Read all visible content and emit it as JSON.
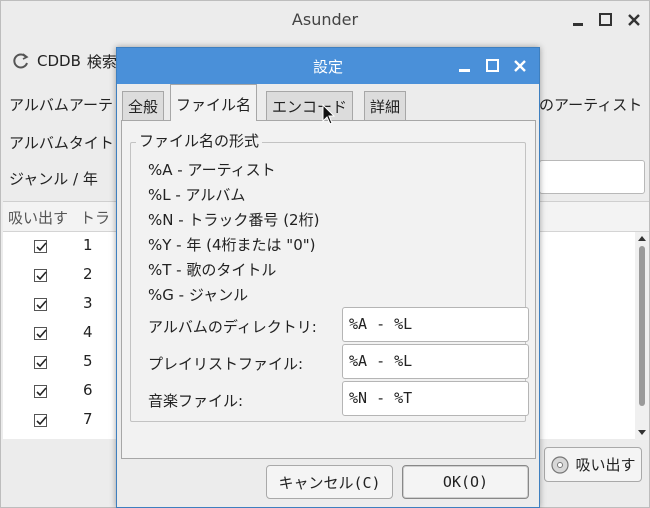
{
  "main": {
    "title": "Asunder",
    "toolbar": {
      "cddb_label": "CDDB",
      "lookup_label": "検索"
    },
    "artist_label": "アルバムアーテ",
    "album_title_label": "アルバムタイト",
    "genre_label": "ジャンル  /  年",
    "right_artist_label": "のアーティスト",
    "tracklist": {
      "headers": [
        "吸い出す",
        "トラ"
      ],
      "rows": [
        {
          "checked": true,
          "num": "1"
        },
        {
          "checked": true,
          "num": "2"
        },
        {
          "checked": true,
          "num": "3"
        },
        {
          "checked": true,
          "num": "4"
        },
        {
          "checked": true,
          "num": "5"
        },
        {
          "checked": true,
          "num": "6"
        },
        {
          "checked": true,
          "num": "7"
        }
      ]
    },
    "rip_button": "吸い出す"
  },
  "dialog": {
    "title": "設定",
    "tabs": [
      {
        "label": "全般",
        "active": false
      },
      {
        "label": "ファイル名",
        "active": true
      },
      {
        "label": "エンコード",
        "active": false
      },
      {
        "label": "詳細",
        "active": false
      }
    ],
    "group_title": "ファイル名の形式",
    "format_lines": [
      "%A - アーティスト",
      "%L - アルバム",
      "%N - トラック番号 (2桁)",
      "%Y - 年 (4桁または \"0\")",
      "%T - 歌のタイトル",
      "%G - ジャンル"
    ],
    "fields": [
      {
        "label": "アルバムのディレクトリ:",
        "value": "%A - %L"
      },
      {
        "label": "プレイリストファイル:",
        "value": "%A - %L"
      },
      {
        "label": "音楽ファイル:",
        "value": "%N - %T"
      }
    ],
    "cancel_button": "キャンセル(C)",
    "ok_button": "OK(O)"
  },
  "colors": {
    "dialog_titlebar": "#4a90d9",
    "window_bg": "#ececec"
  }
}
